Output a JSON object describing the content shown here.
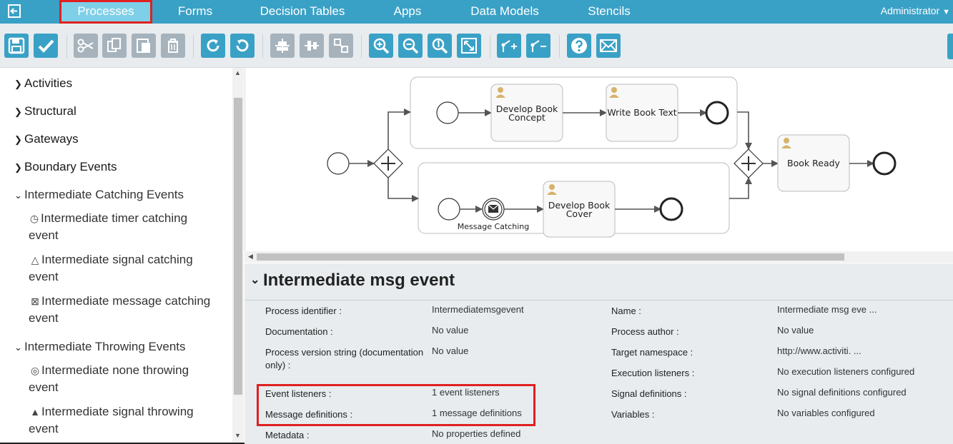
{
  "nav": {
    "items": [
      "Processes",
      "Forms",
      "Decision Tables",
      "Apps",
      "Data Models",
      "Stencils"
    ],
    "user": "Administrator"
  },
  "toolbar": {
    "buttons": [
      "save-icon",
      "validate-icon",
      "cut-icon",
      "copy-icon",
      "paste-icon",
      "delete-icon",
      "redo-icon",
      "undo-icon",
      "align-horizontal-icon",
      "align-vertical-icon",
      "same-size-icon",
      "zoom-in-icon",
      "zoom-out-icon",
      "zoom-actual-icon",
      "zoom-fit-icon",
      "bend-point-add-icon",
      "bend-point-remove-icon",
      "help-icon",
      "feedback-mail-icon"
    ]
  },
  "palette": {
    "groups": {
      "activities": "Activities",
      "structural": "Structural",
      "gateways": "Gateways",
      "boundary": "Boundary Events",
      "catching": "Intermediate Catching Events",
      "throwing": "Intermediate Throwing Events"
    },
    "catching_items": {
      "timer_l1": "Intermediate timer catching",
      "timer_l2": "event",
      "signal_l1": "Intermediate signal catching",
      "signal_l2": "event",
      "message_l1": "Intermediate message catching",
      "message_l2": "event"
    },
    "throwing_items": {
      "none_l1": "Intermediate none throwing",
      "none_l2": "event",
      "signal_l1": "Intermediate signal throwing",
      "signal_l2": "event"
    }
  },
  "diagram": {
    "task1_l1": "Develop Book",
    "task1_l2": "Concept",
    "task2": "Write Book Text",
    "task3_l1": "Develop Book",
    "task3_l2": "Cover",
    "task4": "Book Ready",
    "message_label": "Message Catching"
  },
  "properties": {
    "title": "Intermediate msg event",
    "left": [
      {
        "label": "Process identifier :",
        "value": "Intermediatemsgevent"
      },
      {
        "label": "Documentation :",
        "value": "No value"
      },
      {
        "label": "Process version string (documentation",
        "label2": "only) :",
        "value": "No value"
      },
      {
        "label": "Event listeners :",
        "value": "1 event listeners"
      },
      {
        "label": "Message definitions :",
        "value": "1 message definitions"
      },
      {
        "label": "Metadata :",
        "value": "No properties defined"
      }
    ],
    "right": [
      {
        "label": "Name :",
        "value": "Intermediate msg eve ..."
      },
      {
        "label": "Process author :",
        "value": "No value"
      },
      {
        "label": "Target namespace :",
        "value": "http://www.activiti. ..."
      },
      {
        "label": "Execution listeners :",
        "value": "No execution listeners configured"
      },
      {
        "label": "Signal definitions :",
        "value": "No signal definitions configured"
      },
      {
        "label": "Variables :",
        "value": "No variables configured"
      }
    ]
  }
}
